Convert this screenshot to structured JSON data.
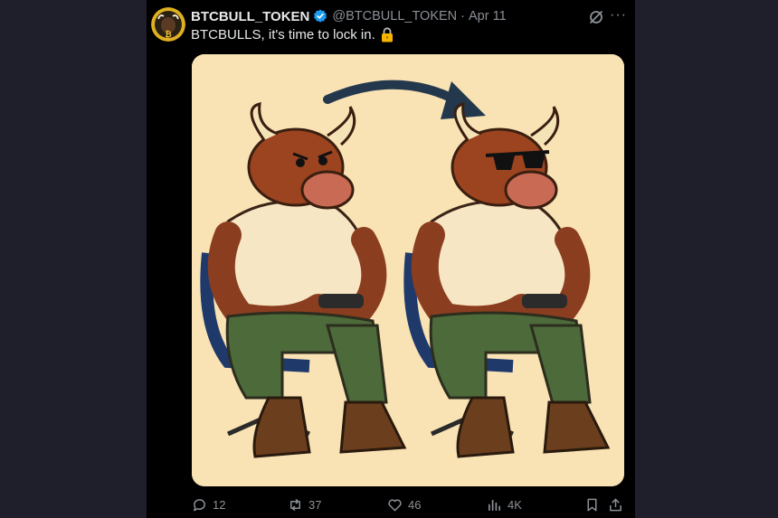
{
  "post": {
    "display_name": "BTCBULL_TOKEN",
    "handle": "@BTCBULL_TOKEN",
    "separator": "·",
    "date": "Apr 11",
    "text": "BTCBULLS, it's time to lock in.",
    "more": "···"
  },
  "actions": {
    "replies": "12",
    "reposts": "37",
    "likes": "46",
    "views": "4K"
  },
  "colors": {
    "verified": "#1d9bf0",
    "muted": "#8b9096",
    "image_bg": "#f9e2b3"
  }
}
